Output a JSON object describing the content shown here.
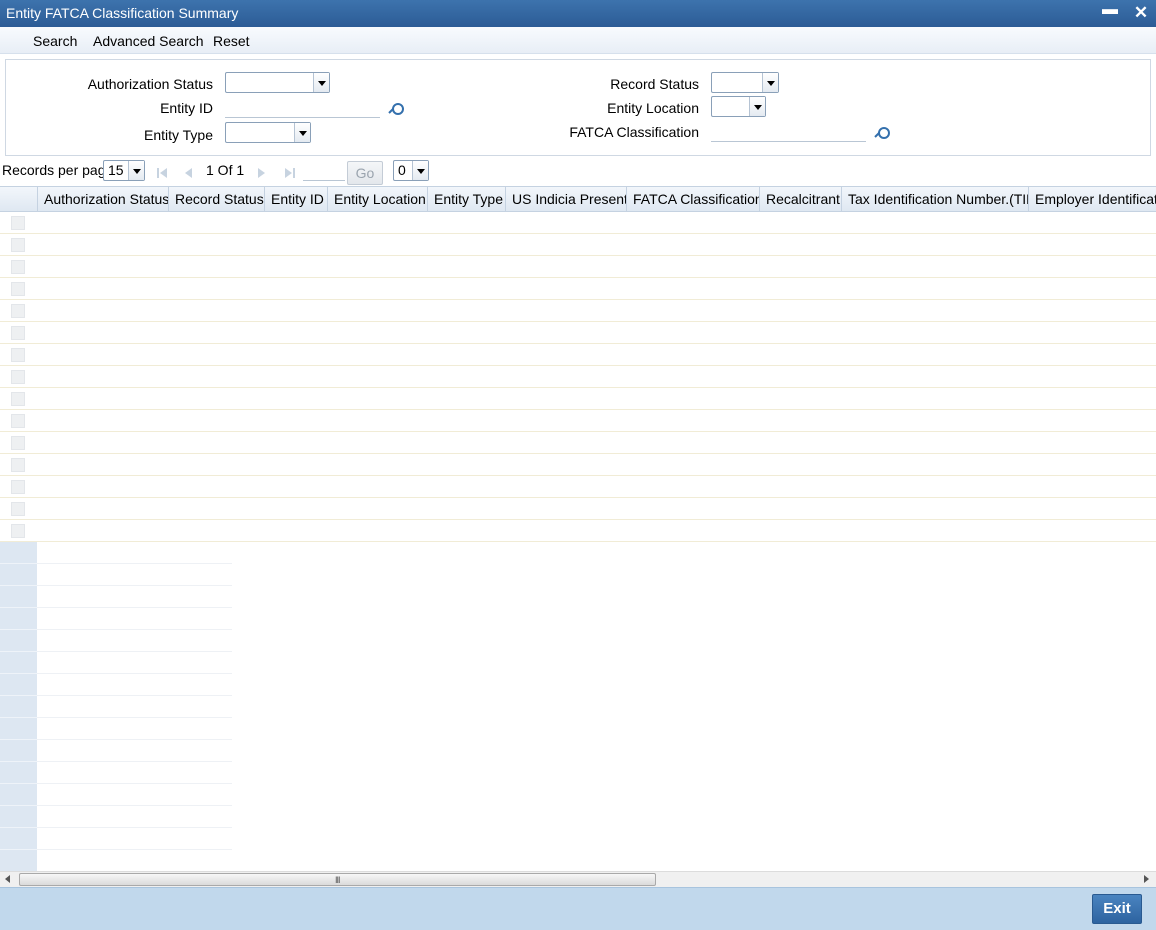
{
  "window": {
    "title": "Entity FATCA Classification Summary",
    "minimize": "▬",
    "close": "✕"
  },
  "toolbar": {
    "search": "Search",
    "advanced_search": "Advanced Search",
    "reset": "Reset"
  },
  "criteria": {
    "authorization_status": {
      "label": "Authorization Status",
      "value": ""
    },
    "record_status": {
      "label": "Record Status",
      "value": ""
    },
    "entity_id": {
      "label": "Entity ID",
      "value": ""
    },
    "entity_location": {
      "label": "Entity Location",
      "value": ""
    },
    "entity_type": {
      "label": "Entity Type",
      "value": ""
    },
    "fatca_classification": {
      "label": "FATCA Classification",
      "value": ""
    }
  },
  "pager": {
    "records_per_page_label": "Records per page",
    "records_per_page": "15",
    "page_info": "1 Of 1",
    "goto_value": "",
    "go_label": "Go",
    "column_count": "0"
  },
  "grid": {
    "columns": [
      "Authorization Status",
      "Record Status",
      "Entity ID",
      "Entity Location",
      "Entity Type",
      "US Indicia Present",
      "FATCA Classification",
      "Recalcitrant",
      "Tax Identification Number.(TIN)",
      "Employer Identificatio"
    ],
    "rows": 15,
    "side_rows": 15
  },
  "scrollbar": {
    "grip": "III"
  },
  "footer": {
    "exit": "Exit"
  }
}
